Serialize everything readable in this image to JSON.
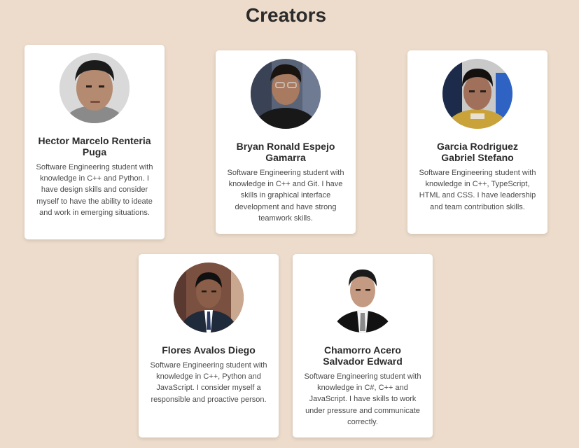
{
  "page": {
    "title": "Creators",
    "background": "#eddccb"
  },
  "creators": [
    {
      "name": "Hector Marcelo Renteria Puga",
      "description": "Software Engineering student with knowledge in C++ and Python. I have design skills and consider myself to have the ability to ideate and work in emerging situations."
    },
    {
      "name": "Bryan Ronald Espejo Gamarra",
      "description": "Software Engineering student with knowledge in C++ and Git. I have skills in graphical interface development and have strong teamwork skills."
    },
    {
      "name": "Garcia Rodriguez Gabriel Stefano",
      "description": "Software Engineering student with knowledge in C++, TypeScript, HTML and CSS. I have leadership and team contribution skills."
    },
    {
      "name": "Flores Avalos Diego",
      "description": "Software Engineering student with knowledge in C++, Python and JavaScript. I consider myself a responsible and proactive person."
    },
    {
      "name": "Chamorro Acero Salvador Edward",
      "description": "Software Engineering student with knowledge in C#, C++ and JavaScript. I have skills to work under pressure and communicate correctly."
    }
  ]
}
